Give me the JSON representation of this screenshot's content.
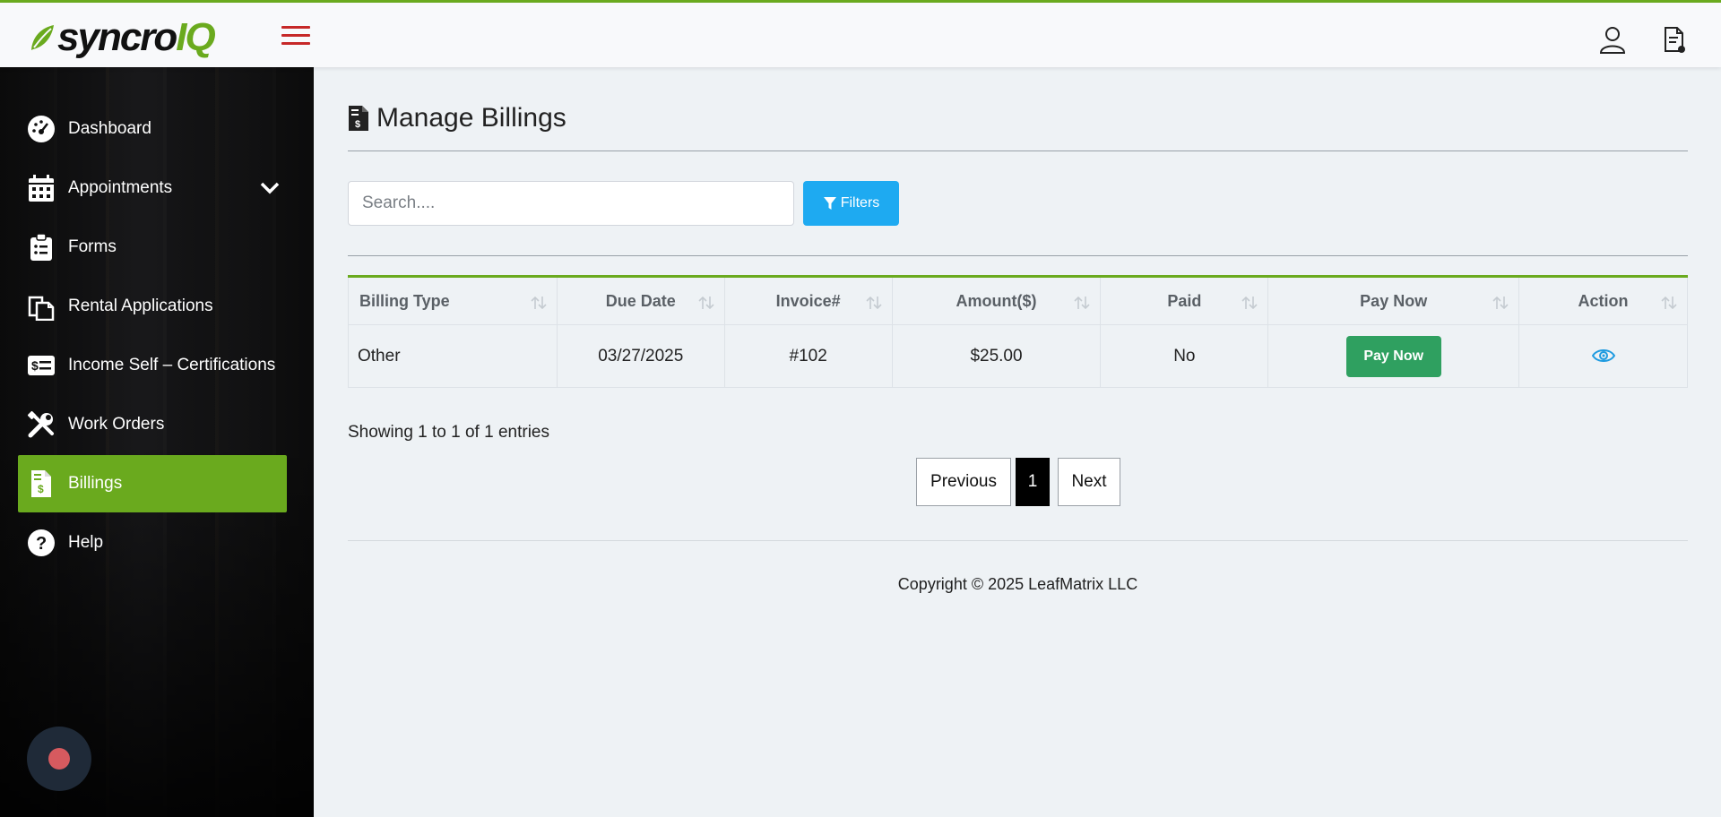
{
  "header": {
    "logo": {
      "part1": "syncro",
      "part2": "IQ"
    },
    "icons": [
      "menu-icon",
      "user-icon",
      "document-icon"
    ]
  },
  "sidebar": {
    "items": [
      {
        "label": "Dashboard",
        "icon": "dashboard-icon",
        "active": false
      },
      {
        "label": "Appointments",
        "icon": "calendar-icon",
        "active": false,
        "expandable": true
      },
      {
        "label": "Forms",
        "icon": "clipboard-icon",
        "active": false
      },
      {
        "label": "Rental Applications",
        "icon": "copy-icon",
        "active": false
      },
      {
        "label": "Income Self – Certifications",
        "icon": "dollar-card-icon",
        "active": false
      },
      {
        "label": "Work Orders",
        "icon": "tools-icon",
        "active": false
      },
      {
        "label": "Billings",
        "icon": "invoice-icon",
        "active": true
      },
      {
        "label": "Help",
        "icon": "help-icon",
        "active": false
      }
    ]
  },
  "main": {
    "title": "Manage Billings",
    "search": {
      "placeholder": "Search....",
      "value": ""
    },
    "filters_label": "Filters",
    "table": {
      "columns": [
        "Billing Type",
        "Due Date",
        "Invoice#",
        "Amount($)",
        "Paid",
        "Pay Now",
        "Action"
      ],
      "rows": [
        {
          "billing_type": "Other",
          "due_date": "03/27/2025",
          "invoice": "#102",
          "amount": "$25.00",
          "paid": "No",
          "pay_now_label": "Pay Now"
        }
      ]
    },
    "showing": "Showing 1 to 1 of 1 entries",
    "pagination": {
      "previous": "Previous",
      "current": "1",
      "next": "Next"
    },
    "copyright": "Copyright © 2025 LeafMatrix LLC"
  },
  "colors": {
    "accent": "#6aaa1e",
    "filters_button": "#1eaaf1",
    "pay_now_button": "#2fa060",
    "hamburger": "#c62828",
    "record_dot": "#d65a5f"
  }
}
